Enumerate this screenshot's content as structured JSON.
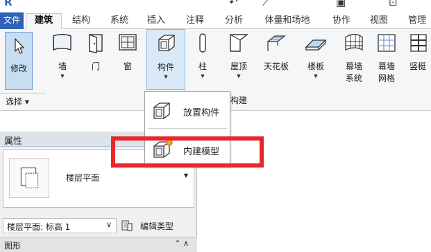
{
  "ribbon_tabs": {
    "file": "文件",
    "architecture": "建筑",
    "structure": "结构",
    "systems": "系统",
    "insert": "插入",
    "annotate": "注释",
    "analyze": "分析",
    "massing": "体量和场地",
    "collaborate": "协作",
    "view": "视图",
    "manage": "管理"
  },
  "ribbon": {
    "modify": "修改",
    "wall": "墙",
    "door": "门",
    "window": "窗",
    "component": "构件",
    "column": "柱",
    "roof": "屋顶",
    "ceiling": "天花板",
    "floor": "楼板",
    "curtain_system_1": "幕墙",
    "curtain_system_2": "系统",
    "curtain_grid_1": "幕墙",
    "curtain_grid_2": "网格",
    "mullion": "竖梃",
    "select": "选择 ▾",
    "build_panel": "构建"
  },
  "component_menu": {
    "place_component": "放置构件",
    "model_in_place": "内建模型"
  },
  "properties": {
    "title": "属性",
    "type_name": "楼层平面",
    "level_selector": "楼层平面: 标高 1",
    "edit_type": "编辑类型",
    "graphics_group": "图形"
  },
  "colors": {
    "highlight": "#e8272a",
    "file_tab": "#2f63b8",
    "selected_button": "#c7ddf2"
  }
}
